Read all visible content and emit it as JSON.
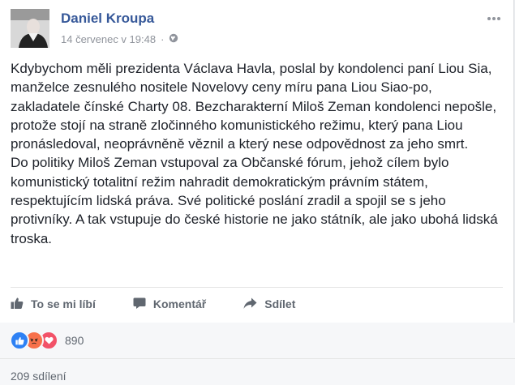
{
  "post": {
    "author": "Daniel Kroupa",
    "timestamp": "14 červenec v 19:48",
    "separator": "·",
    "privacy_icon": "globe-icon",
    "menu_icon": "more-options-icon",
    "paragraphs": [
      "Kdybychom měli prezidenta Václava Havla, poslal by kondolenci paní Liou Sia, manželce zesnulého nositele Novelovy ceny míru pana Liou Siao-po, zakladatele čínské Charty 08. Bezcharakterní Miloš Zeman kondolenci nepošle, protože stojí na straně zločinného komunistického režimu, který pana Liou pronásledoval, neoprávněně věznil a který nese odpovědnost za jeho smrt.",
      "Do politiky Miloš Zeman vstupoval za Občanské fórum, jehož cílem bylo komunistický totalitní režim nahradit demokratickým právním státem, respektujícím lidská práva. Své politické poslání zradil a spojil se s jeho protivníky. A tak vstupuje do české historie ne jako státník, ale jako ubohá lidská troska."
    ]
  },
  "actions": {
    "like": "To se mi líbí",
    "comment": "Komentář",
    "share": "Sdílet"
  },
  "reactions": {
    "types": [
      "like",
      "angry",
      "love"
    ],
    "count": "890"
  },
  "shares": "209 sdílení",
  "colors": {
    "author": "#365899",
    "like": "#2e81f4",
    "angry": "#f7714b",
    "love": "#f25268"
  }
}
